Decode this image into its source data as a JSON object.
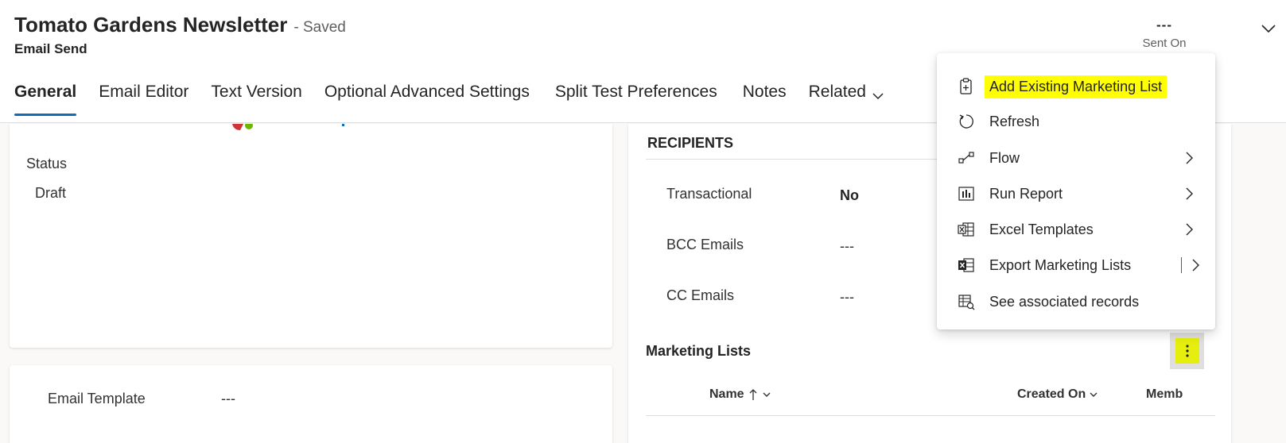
{
  "header": {
    "title": "Tomato Gardens Newsletter",
    "save_status": "- Saved",
    "entity_type": "Email Send",
    "sent_on_value": "---",
    "sent_on_label": "Sent On",
    "expand_icon": "chevron-down-icon"
  },
  "tabs": [
    {
      "label": "General",
      "active": true
    },
    {
      "label": "Email Editor"
    },
    {
      "label": "Text Version"
    },
    {
      "label": "Optional Advanced Settings"
    },
    {
      "label": "Split Test Preferences"
    },
    {
      "label": "Notes"
    },
    {
      "label": "Related",
      "icon": "chevron-down-icon"
    }
  ],
  "status_section": {
    "label": "Status",
    "value": "Draft"
  },
  "template_section": {
    "label": "Email Template",
    "value": "---"
  },
  "recipients": {
    "title": "RECIPIENTS",
    "fields": [
      {
        "label": "Transactional",
        "value": "No"
      },
      {
        "label": "BCC Emails",
        "value": "---"
      },
      {
        "label": "CC Emails",
        "value": "---"
      }
    ]
  },
  "marketing_lists": {
    "title": "Marketing Lists",
    "more_icon": "more-vertical-icon",
    "columns": [
      {
        "label": "Name",
        "sort": "ascending"
      },
      {
        "label": "Created On"
      },
      {
        "label": "Memb"
      }
    ]
  },
  "context_menu": {
    "items": [
      {
        "label": "Add Existing Marketing List",
        "icon": "clipboard-add-icon",
        "highlighted": true
      },
      {
        "label": "Refresh",
        "icon": "refresh-icon"
      },
      {
        "label": "Flow",
        "icon": "flow-icon",
        "submenu": true
      },
      {
        "label": "Run Report",
        "icon": "report-icon",
        "submenu": true
      },
      {
        "label": "Excel Templates",
        "icon": "excel-templates-icon",
        "submenu": true
      },
      {
        "label": "Export Marketing Lists",
        "icon": "excel-export-icon",
        "split": true
      },
      {
        "label": "See associated records",
        "icon": "associated-records-icon"
      }
    ]
  },
  "colors": {
    "accent": "#0f6cbd",
    "highlight": "#ffff00",
    "more_highlight": "#e6ee0d"
  }
}
